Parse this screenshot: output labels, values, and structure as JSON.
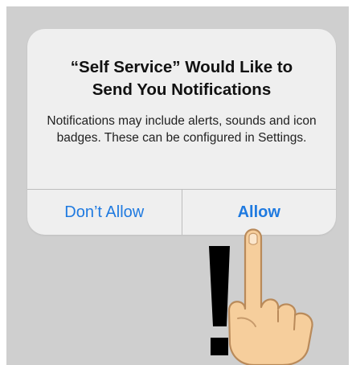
{
  "alert": {
    "title": "“Self Service” Would Like to Send You Notifications",
    "message": "Notifications may include alerts, sounds and icon badges. These can be configured in Settings.",
    "deny_label": "Don’t Allow",
    "allow_label": "Allow"
  },
  "overlay": {
    "annotation_icon": "exclamation-mark-icon",
    "pointer_icon": "pointing-hand-icon"
  },
  "colors": {
    "button_text": "#1f7ae0",
    "alert_background": "#efefef",
    "screen_background": "#cfcfcf"
  }
}
